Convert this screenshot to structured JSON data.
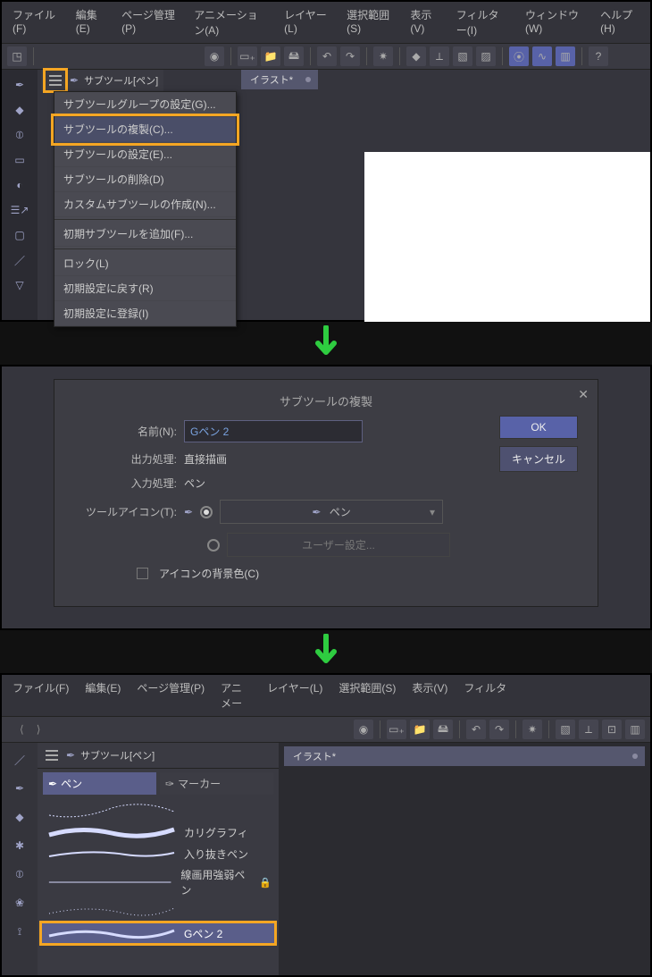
{
  "menus": {
    "file": "ファイル(F)",
    "edit": "編集(E)",
    "page": "ページ管理(P)",
    "anim": "アニメーション(A)",
    "layer": "レイヤー(L)",
    "select": "選択範囲(S)",
    "view": "表示(V)",
    "filter": "フィルター(I)",
    "window": "ウィンドウ(W)",
    "help": "ヘルプ(H)"
  },
  "tab_name": "イラスト*",
  "subtool_label": "サブツール[ペン]",
  "dropdown": {
    "group_settings": "サブツールグループの設定(G)...",
    "duplicate": "サブツールの複製(C)...",
    "settings": "サブツールの設定(E)...",
    "delete": "サブツールの削除(D)",
    "custom": "カスタムサブツールの作成(N)...",
    "add_default": "初期サブツールを追加(F)...",
    "lock": "ロック(L)",
    "reset": "初期設定に戻す(R)",
    "register": "初期設定に登録(I)"
  },
  "dialog": {
    "title": "サブツールの複製",
    "name_label": "名前(N):",
    "name_value": "Gペン 2",
    "output_label": "出力処理:",
    "output_value": "直接描画",
    "input_label": "入力処理:",
    "input_value": "ペン",
    "icon_label": "ツールアイコン(T):",
    "icon_combo": "ペン",
    "user_setting": "ユーザー設定...",
    "bg_label": "アイコンの背景色(C)",
    "ok": "OK",
    "cancel": "キャンセル"
  },
  "panel3": {
    "tab_pen": "ペン",
    "tab_marker": "マーカー",
    "brush_calligraphy": "カリグラフィ",
    "brush_iri": "入り抜きペン",
    "brush_line": "線画用強弱ペン",
    "brush_gpen2": "Gペン 2",
    "filter_label": "フィルタ"
  }
}
